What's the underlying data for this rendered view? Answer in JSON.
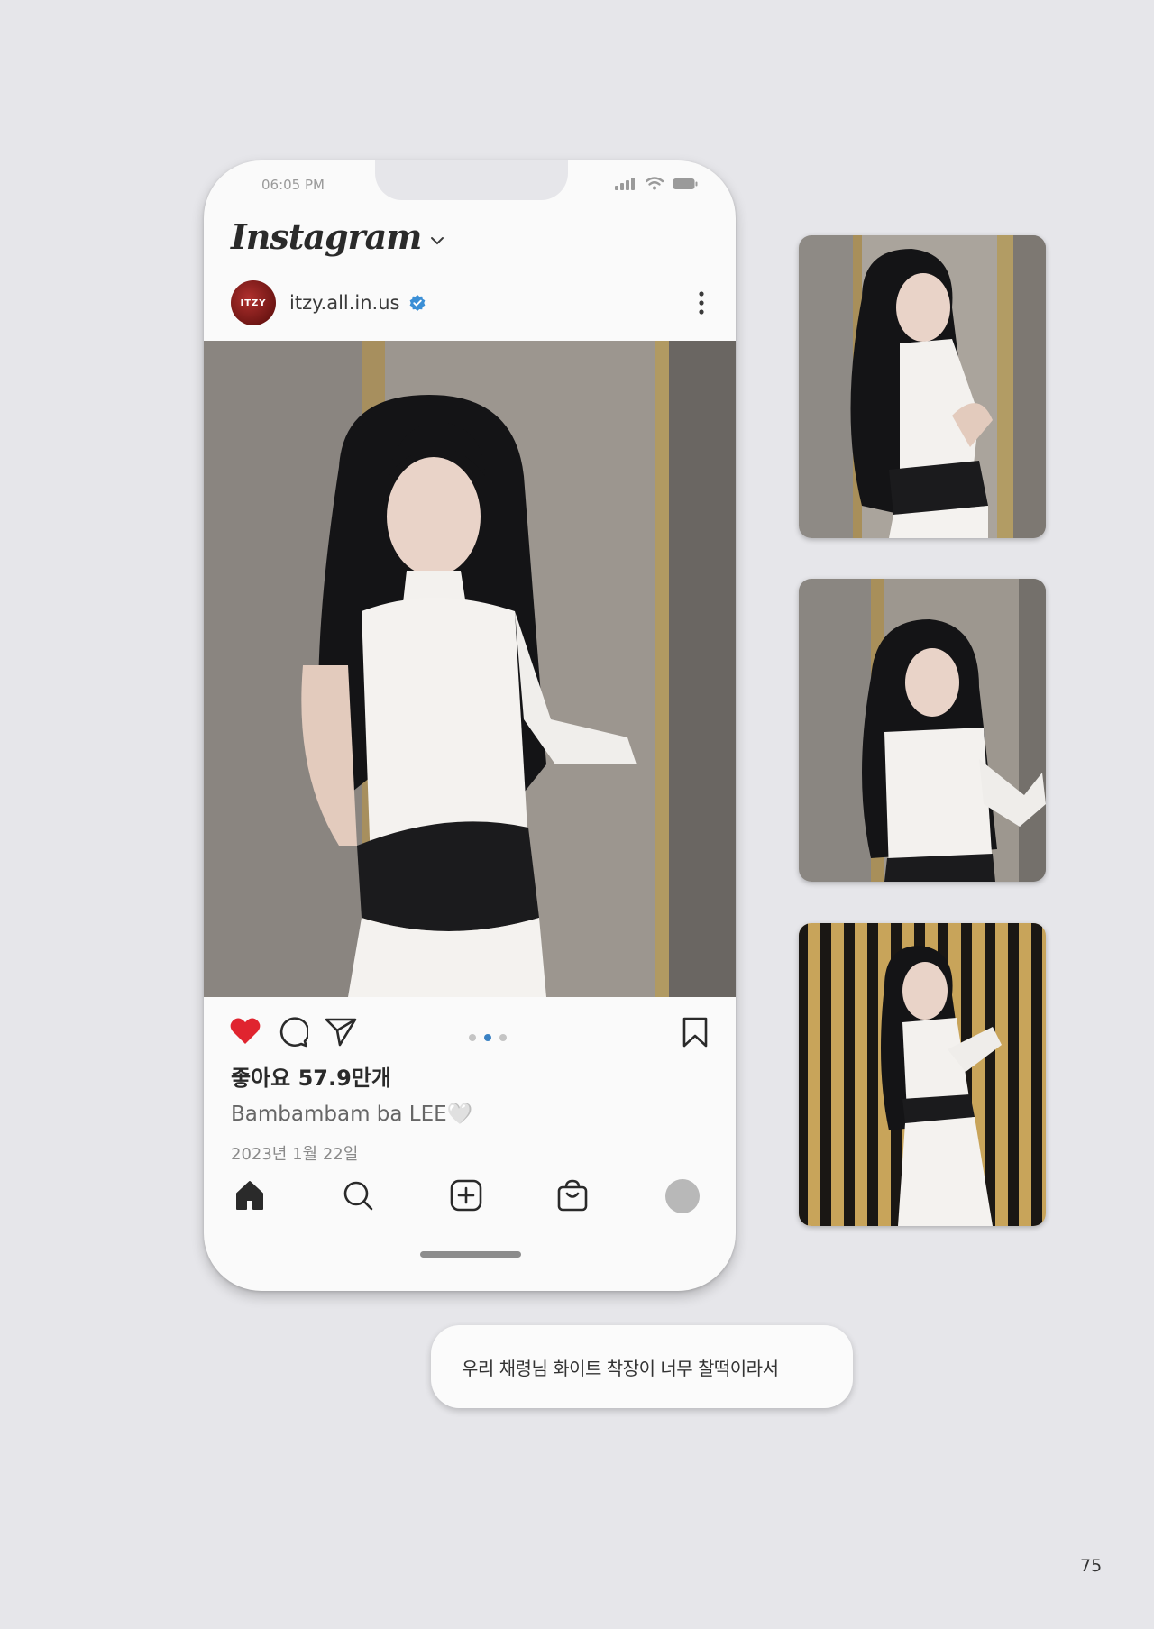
{
  "status_bar": {
    "time": "06:05 PM"
  },
  "app": {
    "logo": "Instagram",
    "logo_dropdown_icon": "chevron-down-icon"
  },
  "post": {
    "account": {
      "avatar_text": "ITZY",
      "username": "itzy.all.in.us",
      "verified": true
    },
    "carousel": {
      "total": 3,
      "current_index": 2
    },
    "likes_text": "좋아요 57.9만개",
    "liked": true,
    "caption": "Bambambam ba LEE🤍",
    "date": "2023년 1월 22일"
  },
  "actions": {
    "icons": [
      "heart-icon",
      "comment-icon",
      "share-icon",
      "bookmark-icon",
      "more-icon"
    ]
  },
  "bottom_nav": {
    "items": [
      {
        "icon": "home-icon",
        "label": "Home"
      },
      {
        "icon": "search-icon",
        "label": "Search"
      },
      {
        "icon": "add-post-icon",
        "label": "New post"
      },
      {
        "icon": "shop-icon",
        "label": "Shop"
      },
      {
        "icon": "profile-icon",
        "label": "Profile"
      }
    ]
  },
  "side_photos": [
    {
      "id": "photo-1"
    },
    {
      "id": "photo-2"
    },
    {
      "id": "photo-3"
    }
  ],
  "speech_bubble": {
    "text": "우리 채령님 화이트 착장이 너무 찰떡이라서"
  },
  "page": {
    "number": "75"
  },
  "colors": {
    "background": "#e6e6ea",
    "like_red": "#e0242f",
    "verified_blue": "#3b8fd6",
    "active_dot": "#3b82c4"
  }
}
